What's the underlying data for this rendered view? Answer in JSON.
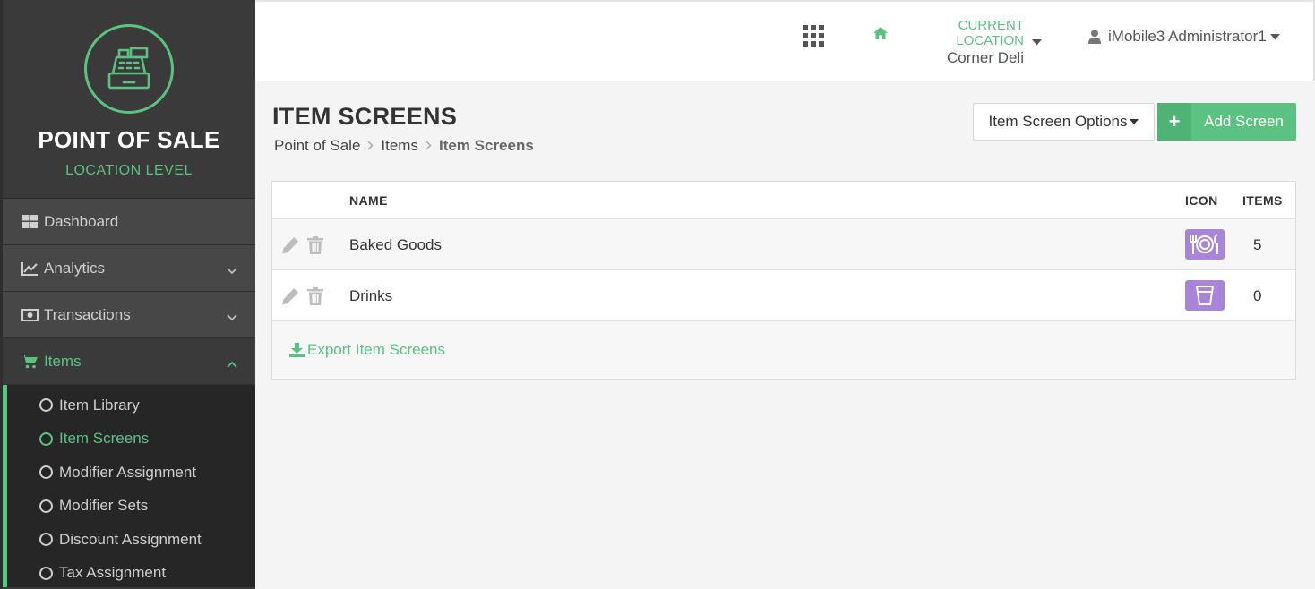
{
  "brand": {
    "title": "POINT OF SALE",
    "subtitle": "LOCATION LEVEL",
    "logo_icon": "cash-register-icon"
  },
  "sidebar": {
    "items": [
      {
        "label": "Dashboard",
        "icon": "dashboard-icon"
      },
      {
        "label": "Analytics",
        "icon": "line-chart-icon"
      },
      {
        "label": "Transactions",
        "icon": "money-icon"
      },
      {
        "label": "Items",
        "icon": "cart-icon"
      }
    ],
    "subitems": [
      {
        "label": "Item Library"
      },
      {
        "label": "Item Screens"
      },
      {
        "label": "Modifier Assignment"
      },
      {
        "label": "Modifier Sets"
      },
      {
        "label": "Discount Assignment"
      },
      {
        "label": "Tax Assignment"
      }
    ]
  },
  "topbar": {
    "location_label": "CURRENT LOCATION",
    "location_value": "Corner Deli",
    "user": "iMobile3 Administrator1"
  },
  "page": {
    "title": "ITEM SCREENS",
    "breadcrumb": [
      "Point of Sale",
      "Items",
      "Item Screens"
    ],
    "options_label": "Item Screen Options",
    "add_label": "Add Screen",
    "add_glyph": "+"
  },
  "table": {
    "headers": {
      "name": "NAME",
      "icon": "ICON",
      "items": "ITEMS"
    },
    "rows": [
      {
        "name": "Baked Goods",
        "icon": "plate-cutlery-icon",
        "items": "5"
      },
      {
        "name": "Drinks",
        "icon": "cup-icon",
        "items": "0"
      }
    ],
    "export_label": "Export Item Screens"
  },
  "colors": {
    "accent": "#5cc281",
    "sidebar": "#3a3a3a",
    "icon_badge": "#a885d8"
  }
}
